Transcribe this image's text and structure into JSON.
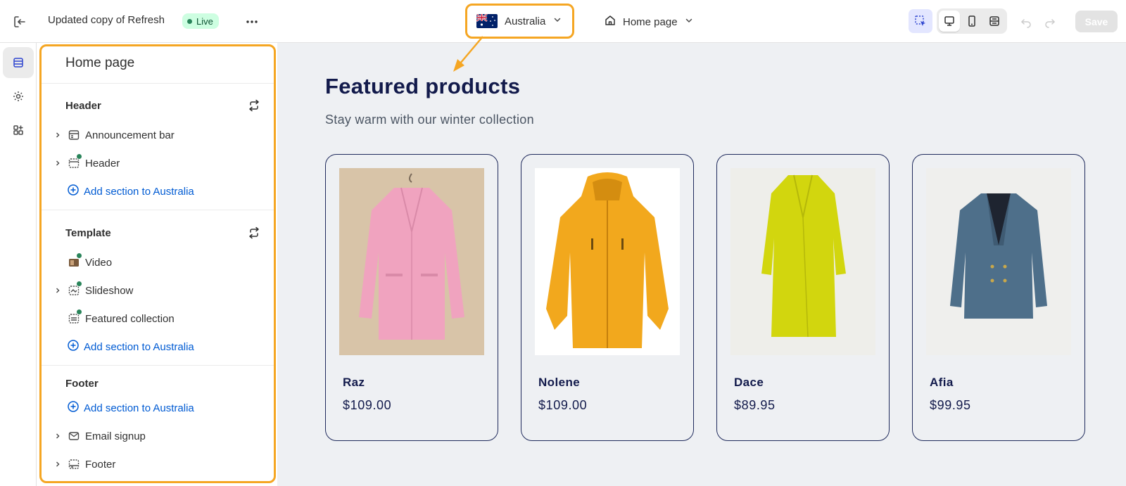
{
  "topbar": {
    "title": "Updated copy of Refresh",
    "live_label": "Live",
    "market_label": "Australia",
    "page_label": "Home page",
    "save_label": "Save"
  },
  "sidebar": {
    "title": "Home page",
    "groups": [
      {
        "title": "Header",
        "items": [
          {
            "label": "Announcement bar",
            "icon": "section-icon"
          },
          {
            "label": "Header",
            "icon": "header-section-icon"
          }
        ],
        "add_label": "Add section to Australia"
      },
      {
        "title": "Template",
        "items": [
          {
            "label": "Video",
            "icon": "video-section-icon"
          },
          {
            "label": "Slideshow",
            "icon": "slideshow-section-icon"
          },
          {
            "label": "Featured collection",
            "icon": "collection-section-icon"
          }
        ],
        "add_label": "Add section to Australia"
      },
      {
        "title": "Footer",
        "add_label": "Add section to Australia",
        "items": [
          {
            "label": "Email signup",
            "icon": "email-section-icon"
          },
          {
            "label": "Footer",
            "icon": "footer-section-icon"
          }
        ]
      }
    ]
  },
  "preview": {
    "title": "Featured products",
    "subtitle": "Stay warm with our winter collection",
    "products": [
      {
        "name": "Raz",
        "price": "$109.00",
        "color": "#f0a3bf"
      },
      {
        "name": "Nolene",
        "price": "$109.00",
        "color": "#f2a81d"
      },
      {
        "name": "Dace",
        "price": "$89.95",
        "color": "#d2d60e"
      },
      {
        "name": "Afia",
        "price": "$99.95",
        "color": "#4e6f8a"
      }
    ]
  },
  "colors": {
    "highlight": "#f5a623",
    "link": "#005bd3",
    "live_bg": "#cdfee1",
    "heading": "#121a4b"
  }
}
